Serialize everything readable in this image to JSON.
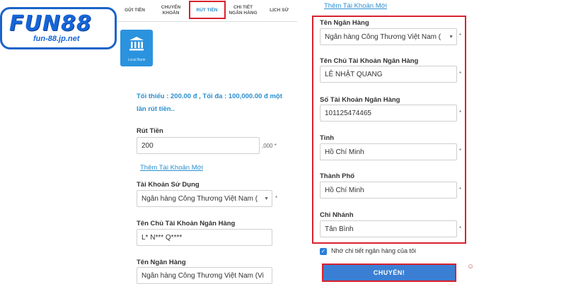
{
  "logo": {
    "main": "FUN88",
    "sub": "fun-88.jp.net"
  },
  "tabs": [
    {
      "label": "GỬI TIỀN"
    },
    {
      "label": "CHUYỂN KHOẢN"
    },
    {
      "label": "RÚT TIỀN",
      "active": true
    },
    {
      "label": "CHI TIẾT NGÂN HÀNG"
    },
    {
      "label": "LỊCH SỬ"
    }
  ],
  "left": {
    "bank_tile_caption": "Local Bank",
    "info_text": "Tối thiểu : 200.00 đ , Tối đa : 100,000.00 đ một lần rút tiền..",
    "withdraw_label": "Rút Tiền",
    "withdraw_value": "200",
    "withdraw_suffix": ",000 *",
    "add_account_link": "Thêm Tài Khoản Mới",
    "account_label": "Tài Khoản Sử Dụng",
    "account_value": "Ngân hàng Công Thương Việt Nam (",
    "holder_label": "Tên Chủ Tài Khoản Ngân Hàng",
    "holder_value": "L* N*** Q****",
    "bank_label": "Tên Ngân Hàng",
    "bank_value": "Ngân hàng Công Thương Việt Nam (Vi"
  },
  "right": {
    "add_account_link": "Thêm Tài Khoản Mới",
    "bank_name_label": "Tên Ngân Hàng",
    "bank_name_value": "Ngân hàng Công Thương Việt Nam (",
    "holder_label": "Tên Chủ Tài Khoản Ngân Hàng",
    "holder_value": "LÊ NHẬT QUANG",
    "account_number_label": "Số Tài Khoản Ngân Hàng",
    "account_number_value": "101125474465",
    "province_label": "Tỉnh",
    "province_value": "Hồ Chí Minh",
    "city_label": "Thành Phố",
    "city_value": "Hồ Chí Minh",
    "branch_label": "Chi Nhánh",
    "branch_value": "Tân Bình",
    "remember_label": "Nhớ chi tiết ngân hàng của tôi",
    "submit_label": "CHUYỂN!"
  },
  "colors": {
    "brand_blue": "#1565d8",
    "link_blue": "#2a8fd0",
    "highlight_red": "#d9212f",
    "button_blue": "#3a7fd4"
  },
  "required_mark": "*"
}
